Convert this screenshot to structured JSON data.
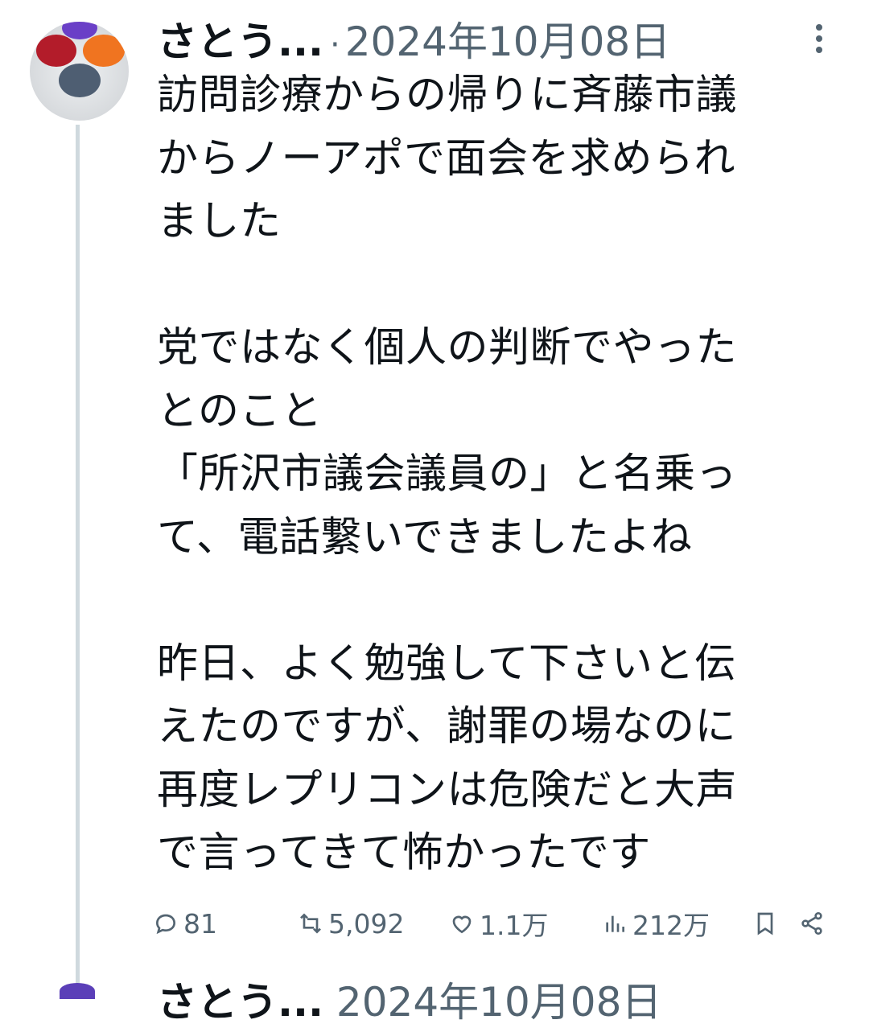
{
  "post": {
    "author_name": "さとう...",
    "separator": "·",
    "date": "2024年10月08日",
    "text": "訪問診療からの帰りに斉藤市議\nからノーアポで面会を求められ\nました\n\n党ではなく個人の判断でやった\nとのこと\n「所沢市議会議員の」と名乗っ\nて、電話繋いできましたよね\n\n昨日、よく勉強して下さいと伝\nえたのですが、謝罪の場なのに\n再度レプリコンは危険だと大声\nで言ってきて怖かったです"
  },
  "actions": {
    "replies": "81",
    "reposts": "5,092",
    "likes": "1.1万",
    "views": "212万"
  },
  "next_post": {
    "author_name": "さとう...",
    "date": "2024年10月08日"
  },
  "colors": {
    "text": "#0f1419",
    "secondary": "#536471",
    "thread_line": "#cfd9de"
  }
}
